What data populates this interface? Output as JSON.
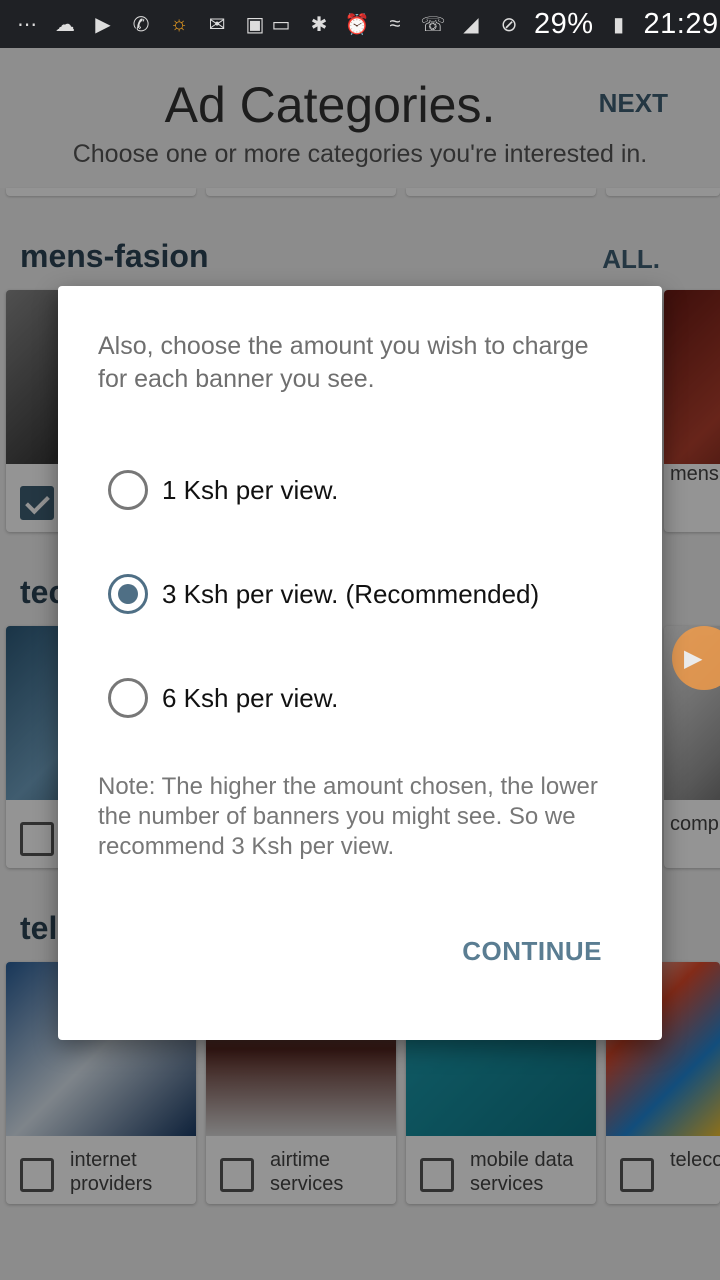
{
  "status_bar": {
    "battery": "29%",
    "time": "21:29",
    "left_icons": [
      "more-icon",
      "cloud-icon",
      "video-icon",
      "whatsapp-icon",
      "brightness-icon",
      "gmail-icon",
      "image-icon"
    ],
    "right_icons": [
      "cast-icon",
      "bluetooth-icon",
      "alarm-icon",
      "wifi-icon",
      "call-icon",
      "signal-icon",
      "dnd-icon",
      "battery-icon"
    ]
  },
  "header": {
    "title": "Ad Categories.",
    "next_label": "NEXT",
    "subtitle": "Choose one or more categories you're interested in."
  },
  "sections": [
    {
      "title": "mens-fasion",
      "all_label": "ALL.",
      "cards": [
        {
          "label": "",
          "checked": true
        },
        {
          "label": "mens traditi wear",
          "checked": false
        }
      ]
    },
    {
      "title": "tec",
      "cards": [
        {
          "label": "",
          "checked": false
        },
        {
          "label": "comp acces",
          "checked": false
        }
      ]
    },
    {
      "title": "tel",
      "cards": [
        {
          "label": "internet providers",
          "checked": false
        },
        {
          "label": "airtime services",
          "checked": false
        },
        {
          "label": "mobile data services",
          "checked": false
        },
        {
          "label": "teleco",
          "checked": false
        }
      ]
    }
  ],
  "dialog": {
    "message": "Also, choose the amount you wish to charge for each banner you see.",
    "options": [
      {
        "label": "1 Ksh per view.",
        "selected": false
      },
      {
        "label": "3 Ksh per view. (Recommended)",
        "selected": true
      },
      {
        "label": "6 Ksh per view.",
        "selected": false
      }
    ],
    "note": "Note: The higher the amount chosen, the lower the number of banners you might see. So we recommend 3 Ksh per view.",
    "continue_label": "CONTINUE"
  },
  "colors": {
    "accent": "#3f5f74",
    "dialog_button": "#5a7d92",
    "radio_selected": "#4f6f85"
  }
}
